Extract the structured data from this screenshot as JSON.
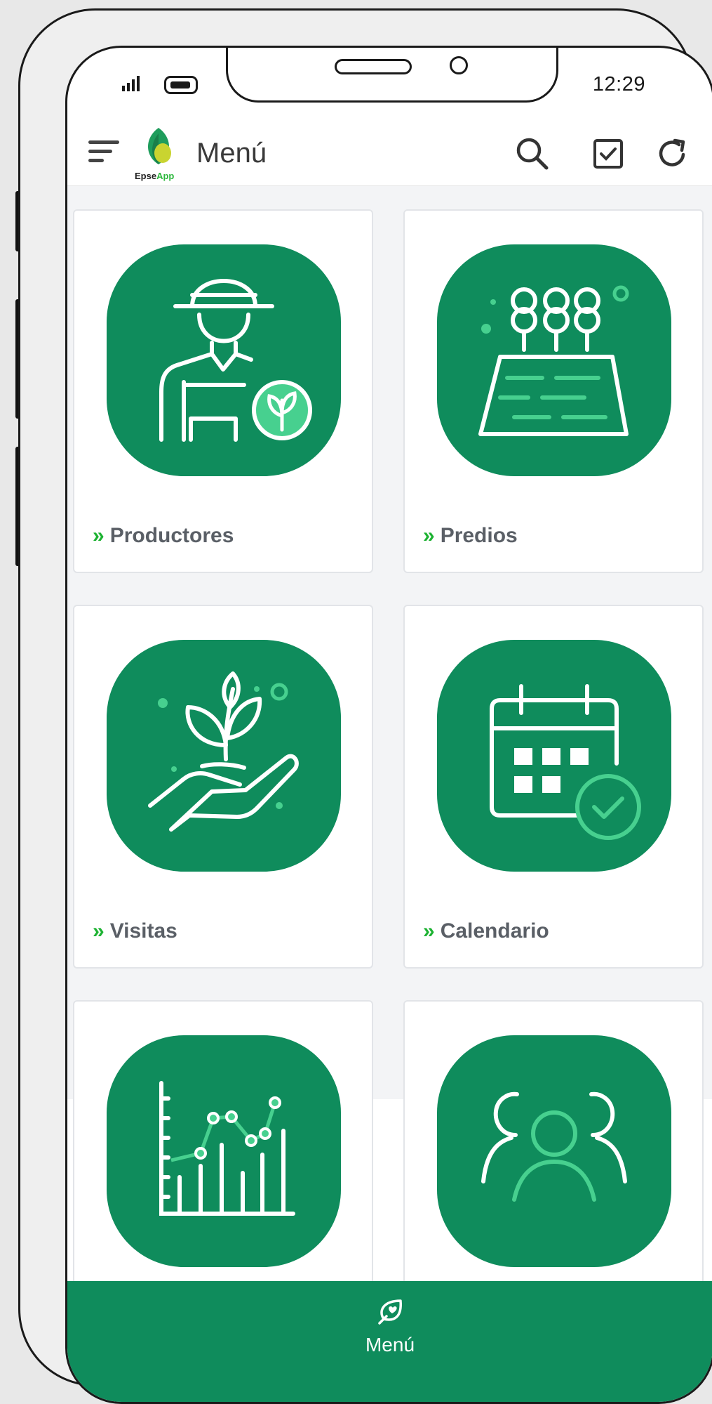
{
  "status_bar": {
    "time": "12:29"
  },
  "app_bar": {
    "title": "Menú",
    "logo_text_a": "Epse",
    "logo_text_b": "App"
  },
  "cards": [
    {
      "label": "Productores",
      "icon": "farmer-icon"
    },
    {
      "label": "Predios",
      "icon": "field-icon"
    },
    {
      "label": "Visitas",
      "icon": "plant-hand-icon"
    },
    {
      "label": "Calendario",
      "icon": "calendar-check-icon"
    },
    {
      "label": "",
      "icon": "chart-icon"
    },
    {
      "label": "",
      "icon": "users-icon"
    }
  ],
  "bottom_nav": {
    "menu_label": "Menú"
  },
  "colors": {
    "primary": "#0f8c5c",
    "accent": "#1db232",
    "label": "#5a5f66",
    "light_green": "#47d08f"
  }
}
